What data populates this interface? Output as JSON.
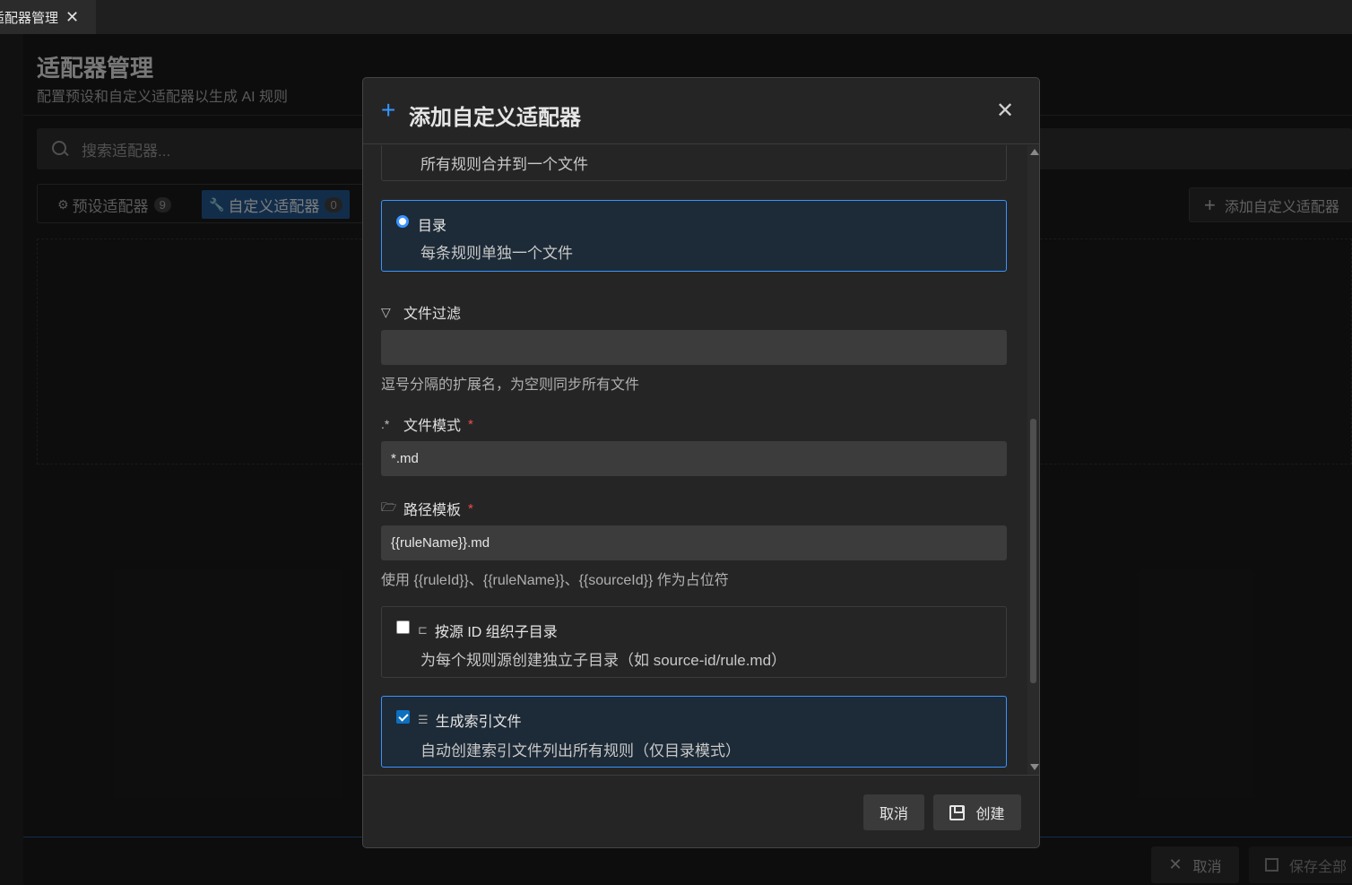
{
  "tab": {
    "label": "适配器管理",
    "close": "✕"
  },
  "page": {
    "title": "适配器管理",
    "subtitle": "配置预设和自定义适配器以生成 AI 规则",
    "search_placeholder": "搜索适配器...",
    "segments": [
      {
        "label": "预设适配器",
        "count": "9",
        "icon": "gear-icon"
      },
      {
        "label": "自定义适配器",
        "count": "0",
        "icon": "wrench-icon"
      }
    ],
    "add_button": "添加自定义适配器",
    "footer_cancel": "取消",
    "footer_save_all": "保存全部"
  },
  "modal": {
    "title": "添加自定义适配器",
    "partial_option_desc": "所有规则合并到一个文件",
    "dir_option": {
      "title": "目录",
      "desc": "每条规则单独一个文件"
    },
    "filter": {
      "label": "文件过滤",
      "value": "",
      "hint": "逗号分隔的扩展名，为空则同步所有文件"
    },
    "pattern": {
      "label": "文件模式",
      "required": "*",
      "value": "*.md"
    },
    "path": {
      "label": "路径模板",
      "required": "*",
      "value": "{{ruleName}}.md",
      "hint": "使用 {{ruleId}}、{{ruleName}}、{{sourceId}} 作为占位符"
    },
    "by_source": {
      "title": "按源 ID 组织子目录",
      "desc": "为每个规则源创建独立子目录（如 source-id/rule.md）",
      "checked": false
    },
    "index_file": {
      "title": "生成索引文件",
      "desc": "自动创建索引文件列出所有规则（仅目录模式）",
      "checked": true
    },
    "cancel": "取消",
    "create": "创建"
  },
  "colors": {
    "accent": "#3794ff",
    "required": "#f14c4c",
    "selected_bg": "#1d2a37"
  }
}
